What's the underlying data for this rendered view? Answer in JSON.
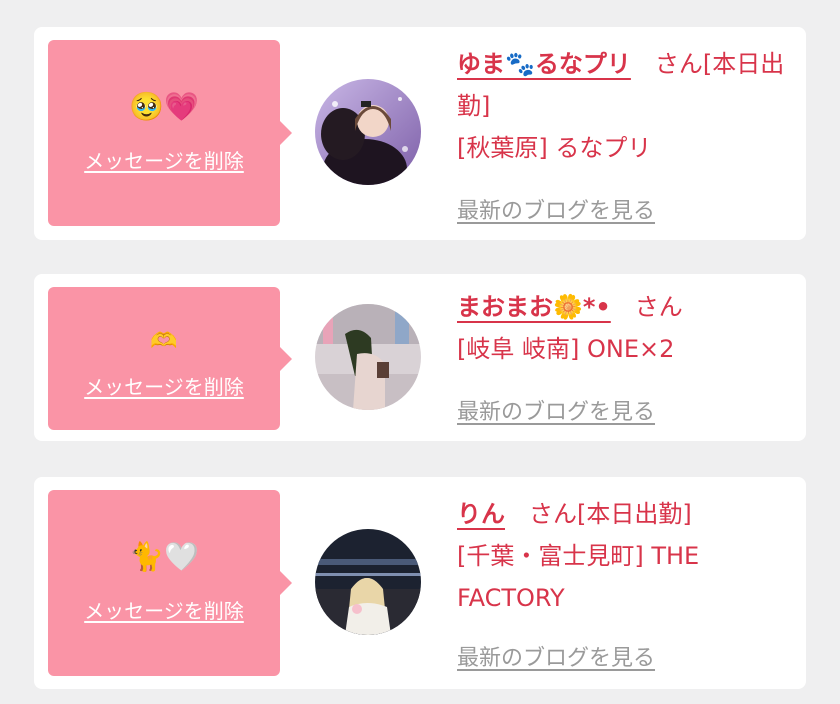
{
  "cards": [
    {
      "message_emoji": "🥹💗",
      "delete_label": "メッセージを削除",
      "name": "ゆま🐾るなプリ",
      "honorific": "さん",
      "status": "[本日出勤]",
      "location": "[秋葉原] るなプリ",
      "blog_label": "最新のブログを見る"
    },
    {
      "message_emoji": "🫶",
      "delete_label": "メッセージを削除",
      "name": "まおまお🌼*•",
      "honorific": "さん",
      "status": "",
      "location": "[岐阜 岐南] ONE×2",
      "blog_label": "最新のブログを見る"
    },
    {
      "message_emoji": "🐈🤍",
      "delete_label": "メッセージを削除",
      "name": "りん",
      "honorific": "さん",
      "status": "[本日出勤]",
      "location": "[千葉・富士見町] THE FACTORY",
      "blog_label": "最新のブログを見る"
    }
  ],
  "colors": {
    "accent": "#d8344a",
    "bubble": "#fa94a6",
    "link_gray": "#9a9a9a",
    "background": "#efeff0"
  }
}
